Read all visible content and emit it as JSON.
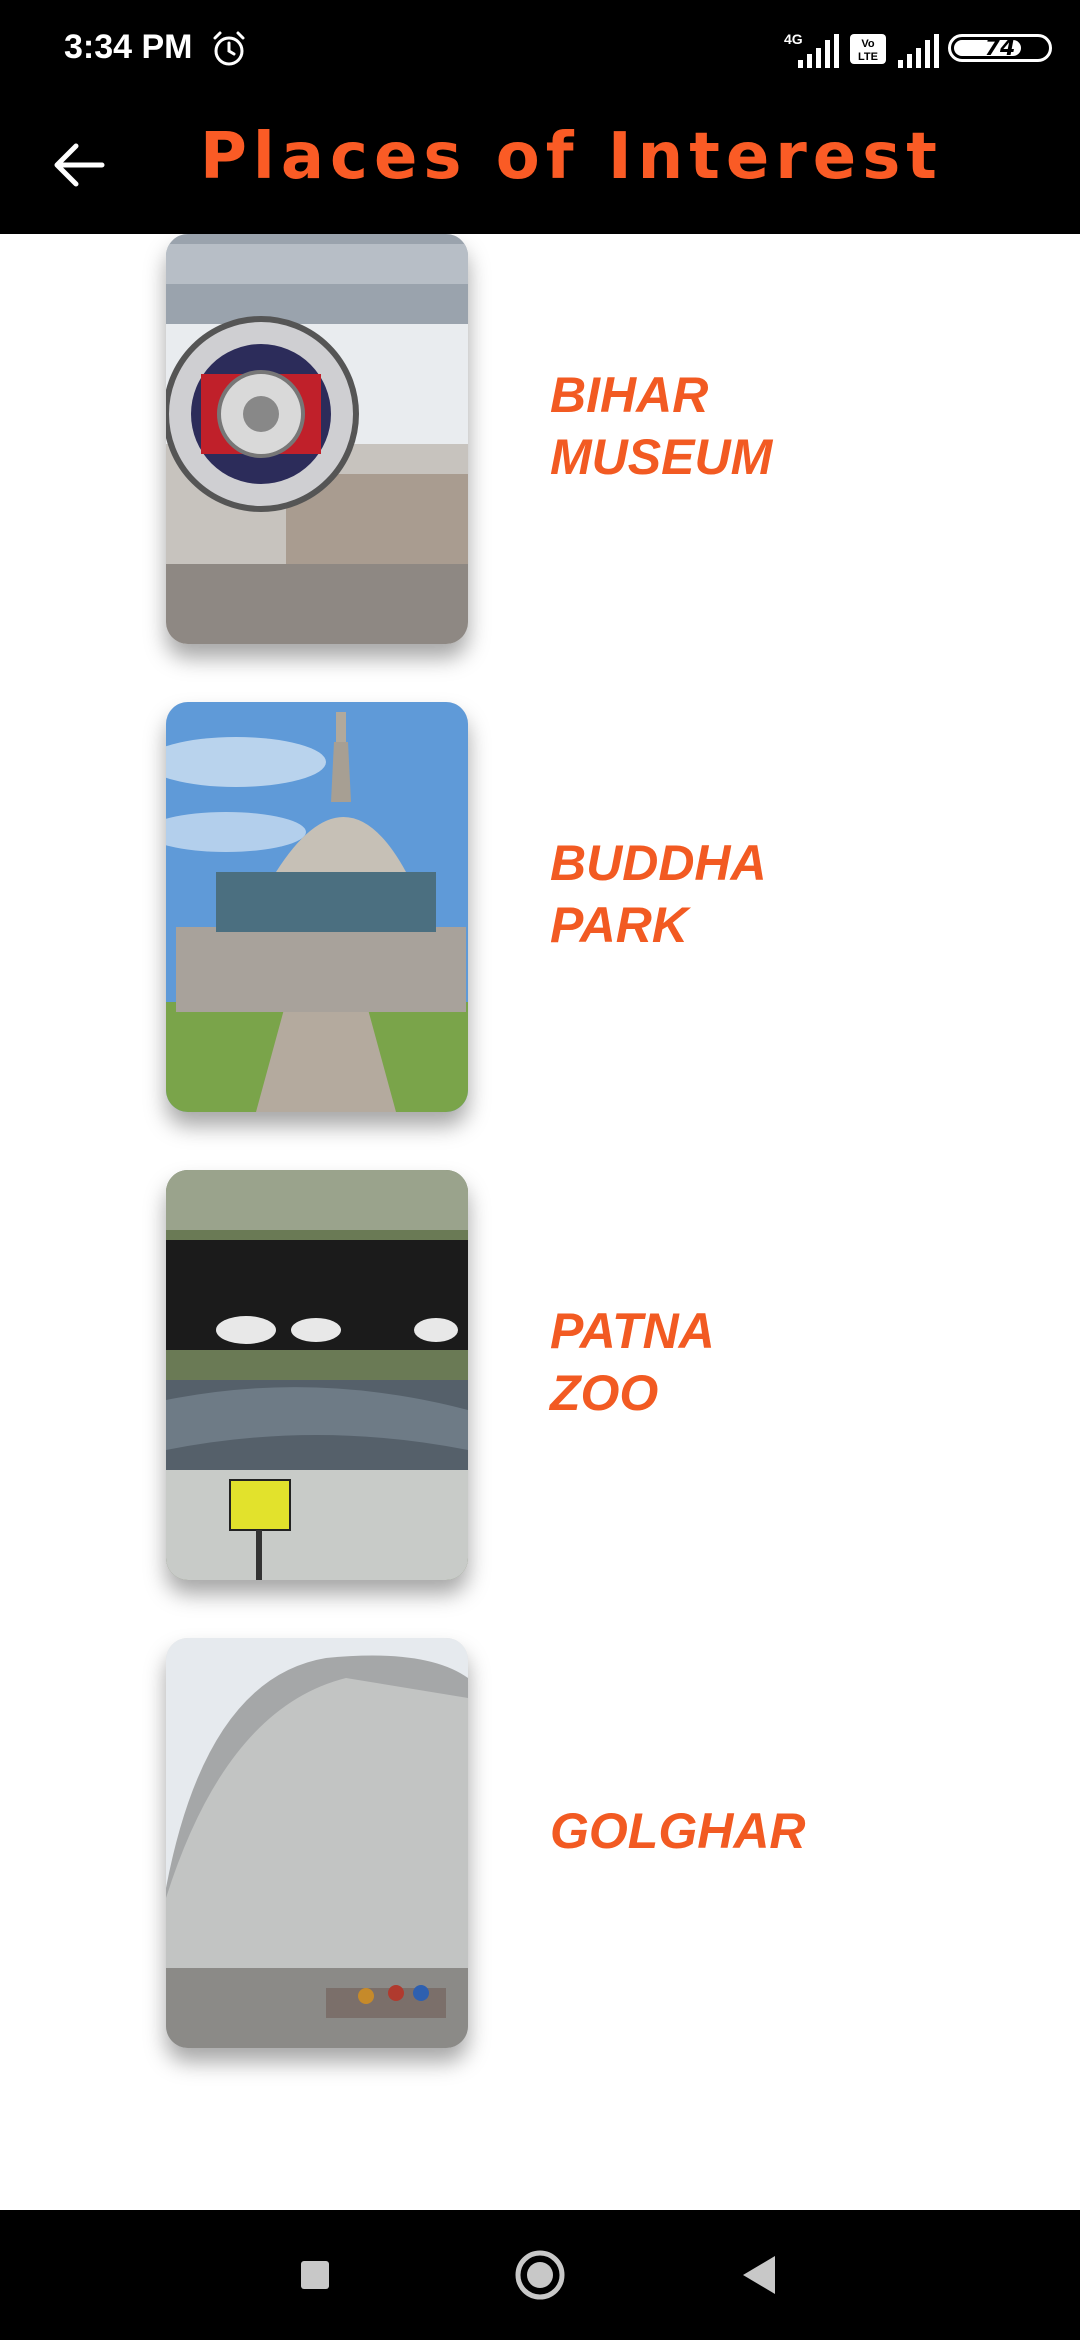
{
  "status_bar": {
    "time": "3:34 PM",
    "network_label": "4G",
    "volte_label": "Vo LTE",
    "battery_level": "74",
    "icons": [
      "alarm-icon",
      "signal-icon",
      "volte-icon",
      "battery-icon"
    ]
  },
  "app_bar": {
    "title": "Places of Interest",
    "back_icon": "arrow-left-icon",
    "title_color": "#fa5b25",
    "background": "#000000"
  },
  "places": [
    {
      "name": "BIHAR\nMUSEUM"
    },
    {
      "name": "BUDDHA\nPARK"
    },
    {
      "name": "PATNA\nZOO"
    },
    {
      "name": "GOLGHAR"
    }
  ],
  "nav_bar": {
    "icons": [
      "square-icon",
      "circle-icon",
      "triangle-icon"
    ]
  },
  "colors": {
    "accent": "#f25a22",
    "bars": "#000000",
    "background": "#ffffff"
  }
}
